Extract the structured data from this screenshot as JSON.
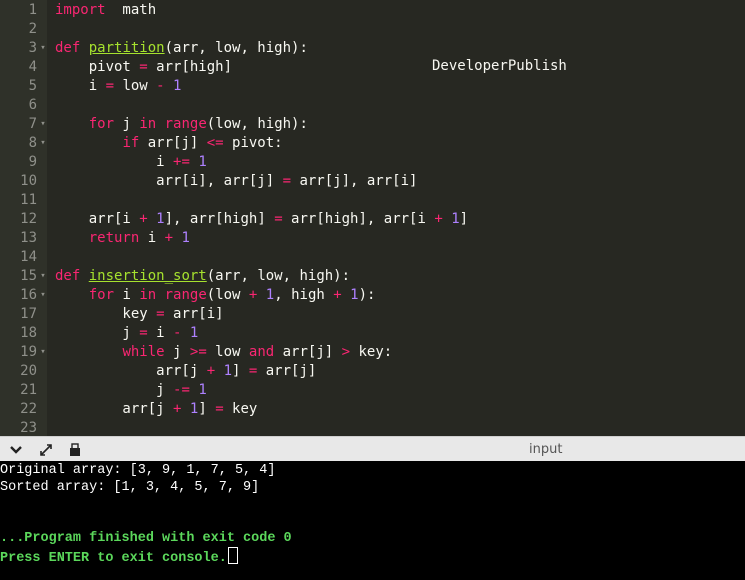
{
  "editor": {
    "watermark": "DeveloperPublish",
    "lines": [
      {
        "n": "1",
        "fold": false,
        "t": [
          [
            "kw",
            "import"
          ],
          [
            "",
            "  math"
          ]
        ]
      },
      {
        "n": "2",
        "fold": false,
        "t": []
      },
      {
        "n": "3",
        "fold": true,
        "t": [
          [
            "kw",
            "def"
          ],
          [
            "",
            " "
          ],
          [
            "fn",
            "partition"
          ],
          [
            "",
            "(arr, low, high):"
          ]
        ]
      },
      {
        "n": "4",
        "fold": false,
        "t": [
          [
            "",
            "    pivot "
          ],
          [
            "op",
            "="
          ],
          [
            "",
            " arr[high]"
          ]
        ]
      },
      {
        "n": "5",
        "fold": false,
        "t": [
          [
            "",
            "    i "
          ],
          [
            "op",
            "="
          ],
          [
            "",
            " low "
          ],
          [
            "op",
            "-"
          ],
          [
            "",
            " "
          ],
          [
            "num",
            "1"
          ]
        ]
      },
      {
        "n": "6",
        "fold": false,
        "t": []
      },
      {
        "n": "7",
        "fold": true,
        "t": [
          [
            "",
            "    "
          ],
          [
            "kw",
            "for"
          ],
          [
            "",
            " j "
          ],
          [
            "kw",
            "in"
          ],
          [
            "",
            " "
          ],
          [
            "bi",
            "range"
          ],
          [
            "",
            "(low, high):"
          ]
        ]
      },
      {
        "n": "8",
        "fold": true,
        "t": [
          [
            "",
            "        "
          ],
          [
            "kw",
            "if"
          ],
          [
            "",
            " arr[j] "
          ],
          [
            "op",
            "<="
          ],
          [
            "",
            " pivot:"
          ]
        ]
      },
      {
        "n": "9",
        "fold": false,
        "t": [
          [
            "",
            "            i "
          ],
          [
            "op",
            "+="
          ],
          [
            "",
            " "
          ],
          [
            "num",
            "1"
          ]
        ]
      },
      {
        "n": "10",
        "fold": false,
        "t": [
          [
            "",
            "            arr[i], arr[j] "
          ],
          [
            "op",
            "="
          ],
          [
            "",
            " arr[j], arr[i]"
          ]
        ]
      },
      {
        "n": "11",
        "fold": false,
        "t": []
      },
      {
        "n": "12",
        "fold": false,
        "t": [
          [
            "",
            "    arr[i "
          ],
          [
            "op",
            "+"
          ],
          [
            "",
            " "
          ],
          [
            "num",
            "1"
          ],
          [
            "",
            "], arr[high] "
          ],
          [
            "op",
            "="
          ],
          [
            "",
            " arr[high], arr[i "
          ],
          [
            "op",
            "+"
          ],
          [
            "",
            " "
          ],
          [
            "num",
            "1"
          ],
          [
            "",
            "]"
          ]
        ]
      },
      {
        "n": "13",
        "fold": false,
        "t": [
          [
            "",
            "    "
          ],
          [
            "kw",
            "return"
          ],
          [
            "",
            " i "
          ],
          [
            "op",
            "+"
          ],
          [
            "",
            " "
          ],
          [
            "num",
            "1"
          ]
        ]
      },
      {
        "n": "14",
        "fold": false,
        "t": []
      },
      {
        "n": "15",
        "fold": true,
        "t": [
          [
            "kw",
            "def"
          ],
          [
            "",
            " "
          ],
          [
            "fn",
            "insertion_sort"
          ],
          [
            "",
            "(arr, low, high):"
          ]
        ]
      },
      {
        "n": "16",
        "fold": true,
        "t": [
          [
            "",
            "    "
          ],
          [
            "kw",
            "for"
          ],
          [
            "",
            " i "
          ],
          [
            "kw",
            "in"
          ],
          [
            "",
            " "
          ],
          [
            "bi",
            "range"
          ],
          [
            "",
            "(low "
          ],
          [
            "op",
            "+"
          ],
          [
            "",
            " "
          ],
          [
            "num",
            "1"
          ],
          [
            "",
            ", high "
          ],
          [
            "op",
            "+"
          ],
          [
            "",
            " "
          ],
          [
            "num",
            "1"
          ],
          [
            "",
            "):"
          ]
        ]
      },
      {
        "n": "17",
        "fold": false,
        "t": [
          [
            "",
            "        key "
          ],
          [
            "op",
            "="
          ],
          [
            "",
            " arr[i]"
          ]
        ]
      },
      {
        "n": "18",
        "fold": false,
        "t": [
          [
            "",
            "        j "
          ],
          [
            "op",
            "="
          ],
          [
            "",
            " i "
          ],
          [
            "op",
            "-"
          ],
          [
            "",
            " "
          ],
          [
            "num",
            "1"
          ]
        ]
      },
      {
        "n": "19",
        "fold": true,
        "t": [
          [
            "",
            "        "
          ],
          [
            "kw",
            "while"
          ],
          [
            "",
            " j "
          ],
          [
            "op",
            ">="
          ],
          [
            "",
            " low "
          ],
          [
            "kw",
            "and"
          ],
          [
            "",
            " arr[j] "
          ],
          [
            "op",
            ">"
          ],
          [
            "",
            " key:"
          ]
        ]
      },
      {
        "n": "20",
        "fold": false,
        "t": [
          [
            "",
            "            arr[j "
          ],
          [
            "op",
            "+"
          ],
          [
            "",
            " "
          ],
          [
            "num",
            "1"
          ],
          [
            "",
            "] "
          ],
          [
            "op",
            "="
          ],
          [
            "",
            " arr[j]"
          ]
        ]
      },
      {
        "n": "21",
        "fold": false,
        "t": [
          [
            "",
            "            j "
          ],
          [
            "op",
            "-="
          ],
          [
            "",
            " "
          ],
          [
            "num",
            "1"
          ]
        ]
      },
      {
        "n": "22",
        "fold": false,
        "t": [
          [
            "",
            "        arr[j "
          ],
          [
            "op",
            "+"
          ],
          [
            "",
            " "
          ],
          [
            "num",
            "1"
          ],
          [
            "",
            "] "
          ],
          [
            "op",
            "="
          ],
          [
            "",
            " key"
          ]
        ]
      },
      {
        "n": "23",
        "fold": false,
        "t": []
      }
    ]
  },
  "toolbar": {
    "input_label": "input",
    "icons": [
      "chevron-down-icon",
      "expand-icon",
      "copy-icon"
    ]
  },
  "console": {
    "lines": [
      {
        "text": "Original array: [3, 9, 1, 7, 5, 4]",
        "style": "w"
      },
      {
        "text": "Sorted array: [1, 3, 4, 5, 7, 9]",
        "style": "w"
      },
      {
        "text": "",
        "style": "w"
      },
      {
        "text": "",
        "style": "w"
      },
      {
        "text": "...Program finished with exit code 0",
        "style": "g"
      },
      {
        "text": "Press ENTER to exit console.",
        "style": "g"
      }
    ]
  },
  "colors": {
    "editor_bg": "#272822",
    "keyword": "#f92672",
    "function": "#a6e22e",
    "number": "#ae81ff",
    "console_green": "#5bd75b"
  }
}
